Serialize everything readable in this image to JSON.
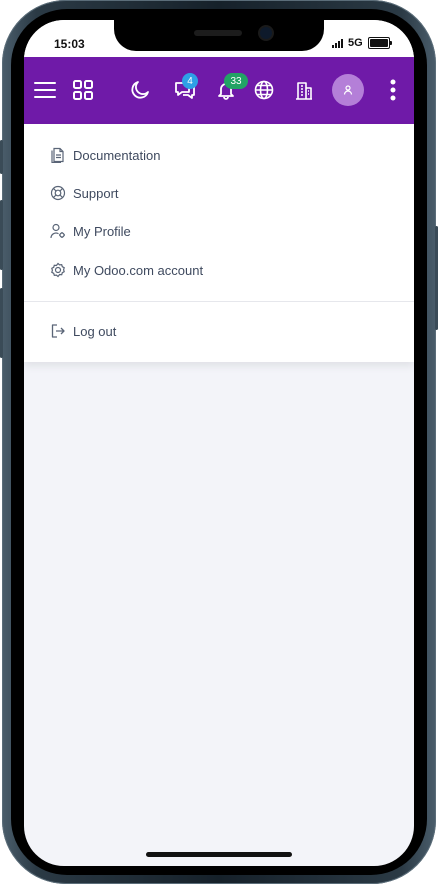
{
  "status_bar": {
    "time": "15:03",
    "network": "5G"
  },
  "navbar": {
    "background": "#6f1aa8",
    "icons": [
      "menu-icon",
      "apps-grid-icon",
      "dark-mode-icon",
      "discuss-icon",
      "bell-icon",
      "globe-icon",
      "company-icon",
      "avatar",
      "more-icon"
    ],
    "discuss_badge": "4",
    "discuss_badge_color": "#2ea0e6",
    "activity_badge": "33",
    "activity_badge_color": "#22a365"
  },
  "user_menu": {
    "items": [
      {
        "label": "Documentation",
        "icon": "document-icon"
      },
      {
        "label": "Support",
        "icon": "lifebuoy-icon"
      },
      {
        "label": "My Profile",
        "icon": "user-gear-icon"
      },
      {
        "label": "My Odoo.com account",
        "icon": "odoo-gear-icon"
      }
    ],
    "logout": {
      "label": "Log out",
      "icon": "logout-icon"
    }
  }
}
